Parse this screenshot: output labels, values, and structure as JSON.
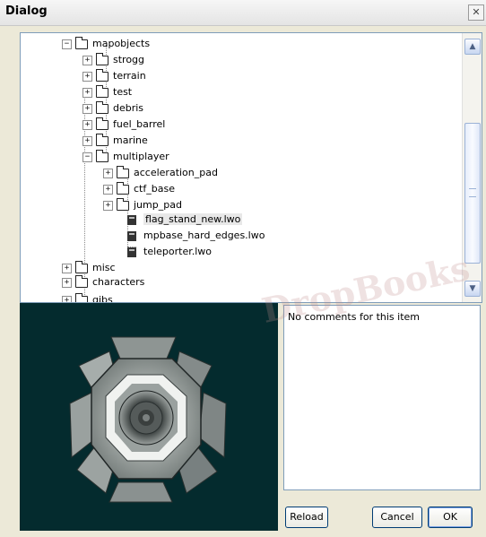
{
  "window": {
    "title": "Dialog",
    "close_glyph": "✕"
  },
  "tree": {
    "rows": [
      {
        "label": "mapobjects",
        "expander": "−",
        "type": "folder"
      },
      {
        "label": "strogg",
        "expander": "+",
        "type": "folder"
      },
      {
        "label": "terrain",
        "expander": "+",
        "type": "folder"
      },
      {
        "label": "test",
        "expander": "+",
        "type": "folder"
      },
      {
        "label": "debris",
        "expander": "+",
        "type": "folder"
      },
      {
        "label": "fuel_barrel",
        "expander": "+",
        "type": "folder"
      },
      {
        "label": "marine",
        "expander": "+",
        "type": "folder"
      },
      {
        "label": "multiplayer",
        "expander": "−",
        "type": "folder"
      },
      {
        "label": "acceleration_pad",
        "expander": "+",
        "type": "folder"
      },
      {
        "label": "ctf_base",
        "expander": "+",
        "type": "folder"
      },
      {
        "label": "jump_pad",
        "expander": "+",
        "type": "folder"
      },
      {
        "label": "flag_stand_new.lwo",
        "type": "file",
        "selected": true
      },
      {
        "label": "mpbase_hard_edges.lwo",
        "type": "file"
      },
      {
        "label": "teleporter.lwo",
        "type": "file"
      },
      {
        "label": "misc",
        "expander": "+",
        "type": "folder"
      },
      {
        "label": "characters",
        "expander": "+",
        "type": "folder"
      },
      {
        "label": "gibs",
        "expander": "+",
        "type": "folder"
      }
    ]
  },
  "scrollbar": {
    "up_glyph": "▲",
    "down_glyph": "▼"
  },
  "comments": {
    "text": "No comments for this item"
  },
  "buttons": {
    "reload": "Reload",
    "cancel": "Cancel",
    "ok": "OK"
  },
  "watermark": {
    "text": "DropBooks"
  }
}
